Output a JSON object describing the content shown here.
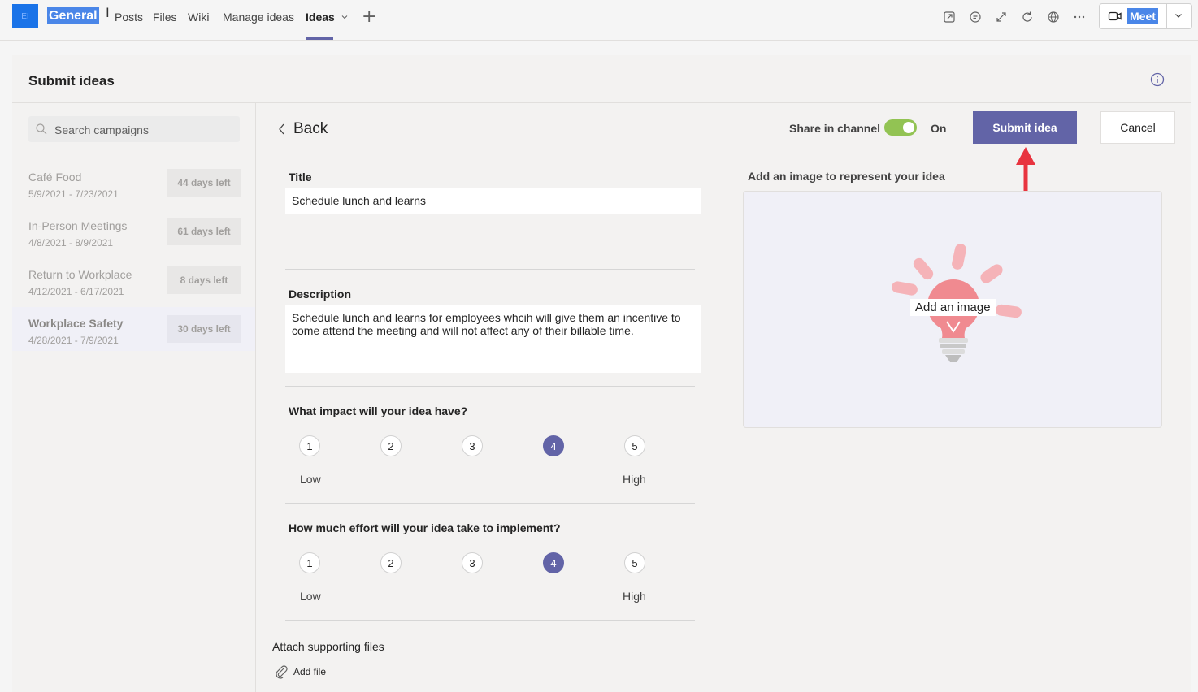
{
  "topbar": {
    "team_initials": "EI",
    "channel": "General",
    "tabs": [
      {
        "label": "Posts"
      },
      {
        "label": "Files"
      },
      {
        "label": "Wiki"
      },
      {
        "label": "Manage ideas"
      },
      {
        "label": "Ideas"
      }
    ],
    "meet_label": "Meet"
  },
  "panel": {
    "title": "Submit ideas"
  },
  "sidebar": {
    "search_placeholder": "Search campaigns",
    "campaigns": [
      {
        "name": "Café Food",
        "dates": "5/9/2021 - 7/23/2021",
        "badge": "44 days left"
      },
      {
        "name": "In-Person Meetings",
        "dates": "4/8/2021 - 8/9/2021",
        "badge": "61 days left"
      },
      {
        "name": "Return to Workplace",
        "dates": "4/12/2021 - 6/17/2021",
        "badge": "8 days left"
      },
      {
        "name": "Workplace Safety",
        "dates": "4/28/2021 - 7/9/2021",
        "badge": "30 days left"
      }
    ]
  },
  "form": {
    "back_label": "Back",
    "share_label": "Share in channel",
    "share_state": "On",
    "share_enabled": true,
    "submit_label": "Submit idea",
    "cancel_label": "Cancel",
    "title_label": "Title",
    "title_value": "Schedule lunch and learns",
    "description_label": "Description",
    "description_value": "Schedule lunch and learns for employees whcih will give them an incentive to come attend the meeting and will not affect any of their billable time.",
    "impact_question": "What impact will your idea have?",
    "effort_question": "How much effort will your idea take to implement?",
    "rating_options": [
      "1",
      "2",
      "3",
      "4",
      "5"
    ],
    "impact_selected": 4,
    "effort_selected": 4,
    "low_label": "Low",
    "high_label": "High",
    "attach_label": "Attach supporting files",
    "add_file_label": "Add file",
    "image_label": "Add an image to represent your idea",
    "add_image_label": "Add an image"
  },
  "colors": {
    "accent": "#6264a7",
    "toggle_on": "#92c353",
    "annotation_arrow": "#e8343f"
  }
}
